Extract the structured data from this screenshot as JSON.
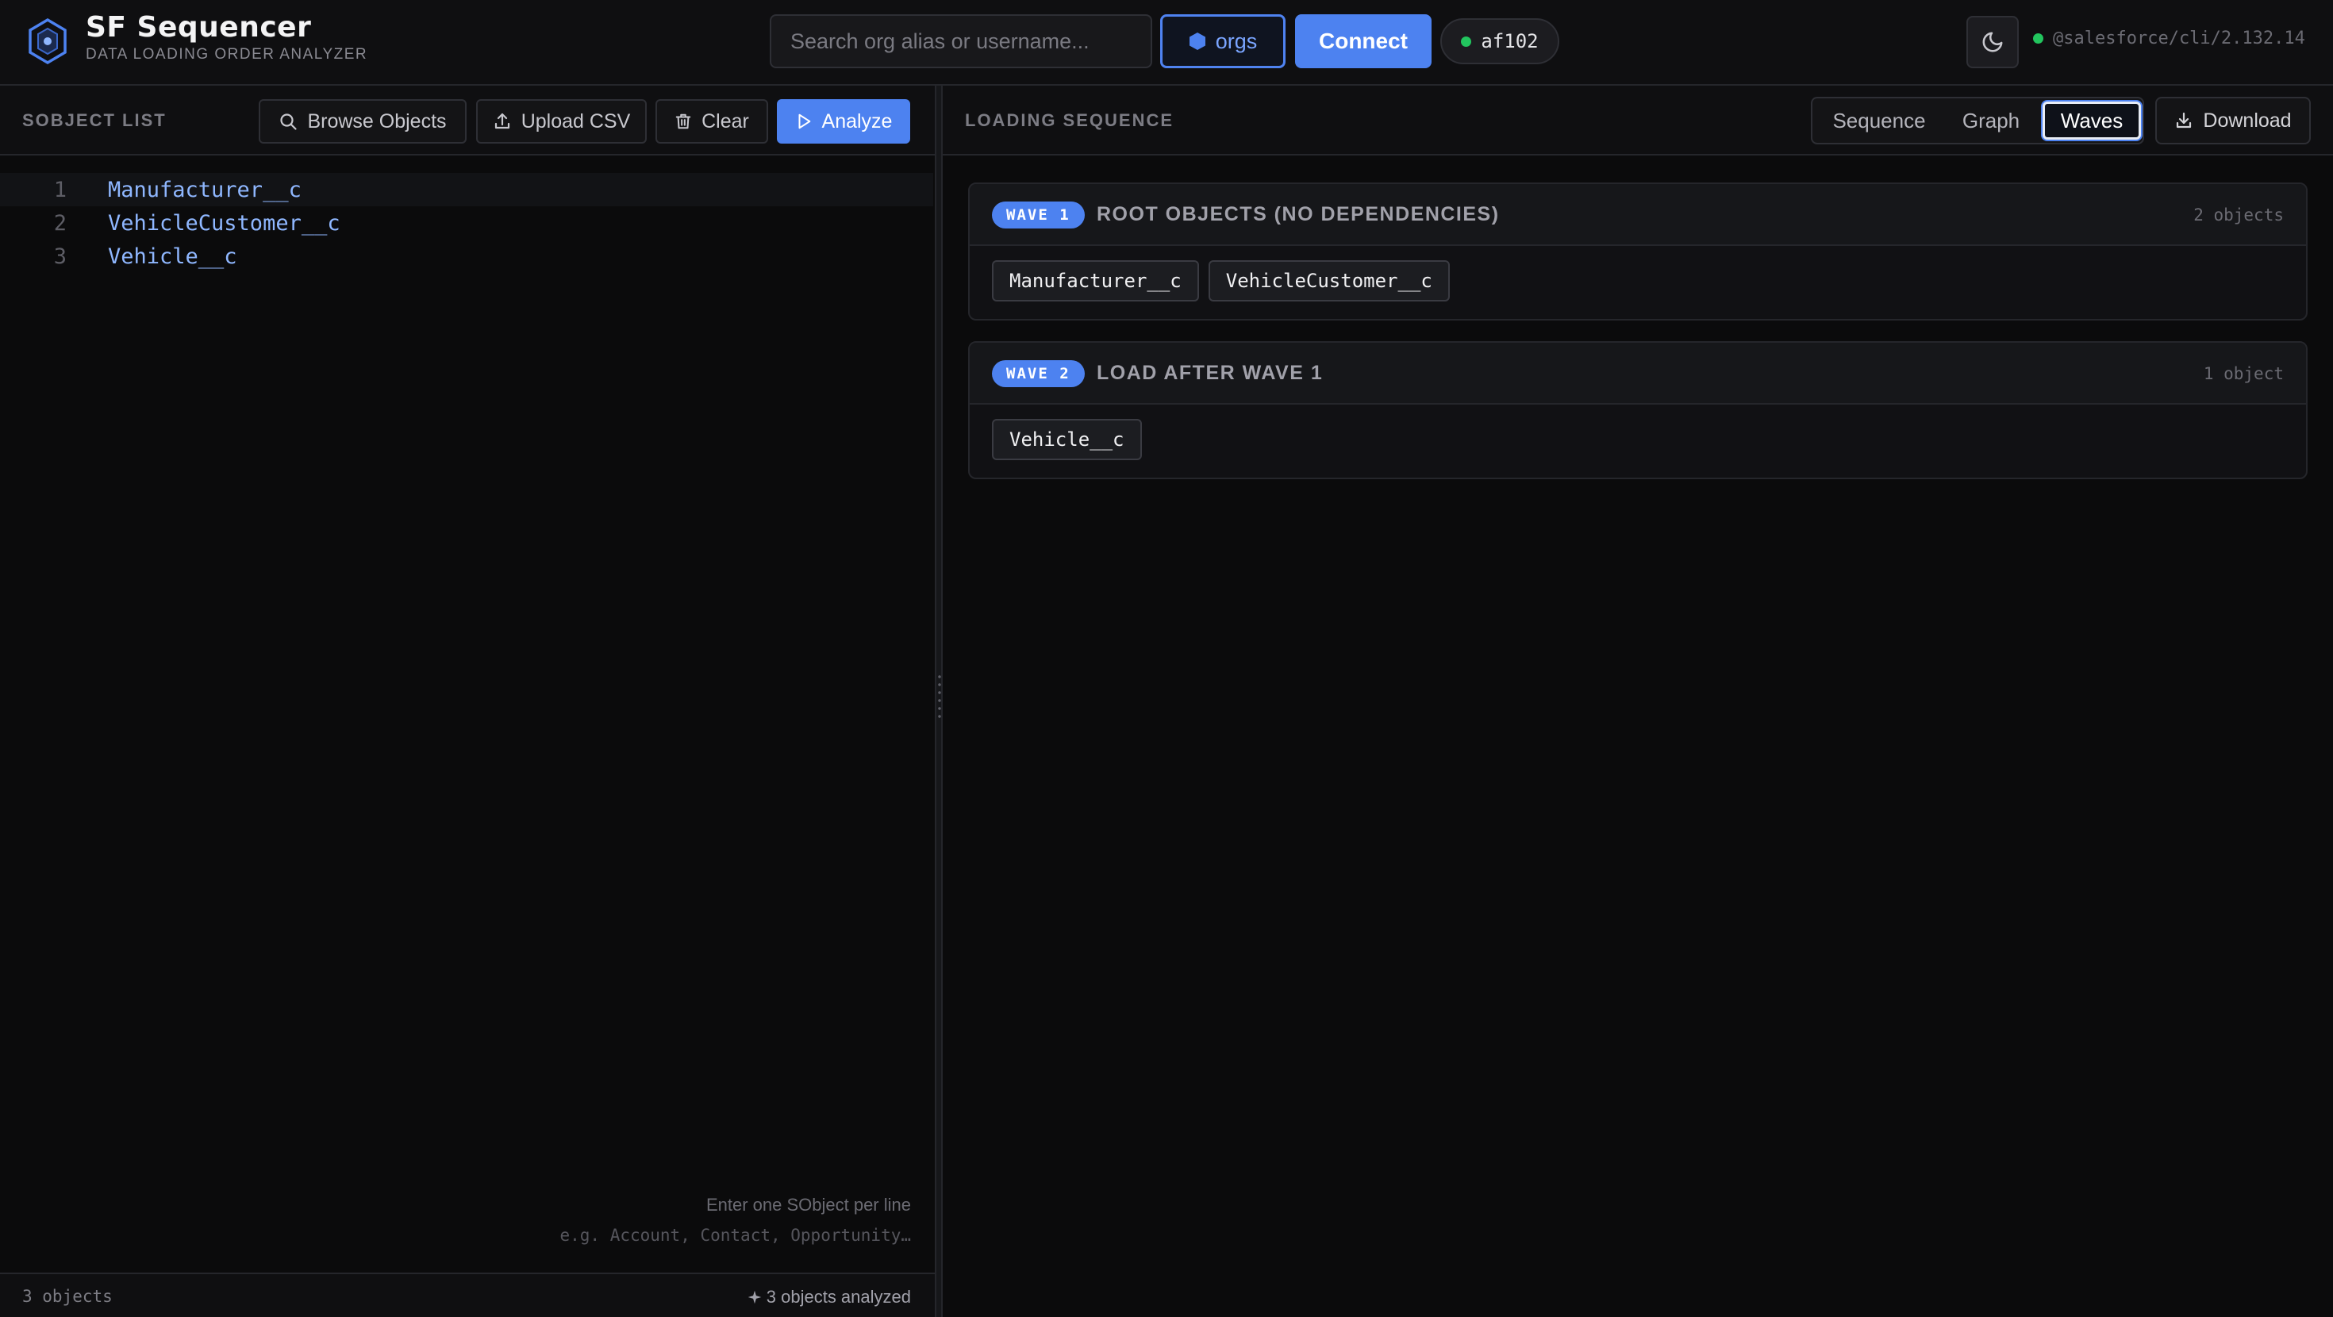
{
  "header": {
    "title": "SF Sequencer",
    "subtitle": "DATA LOADING ORDER ANALYZER",
    "search_placeholder": "Search org alias or username...",
    "orgs_label": "orgs",
    "connect_label": "Connect",
    "org_alias": "af102",
    "cli_version": "@salesforce/cli/2.132.14",
    "status_color": "#22c55e",
    "accent_color": "#4d82f0"
  },
  "left_panel": {
    "label": "SOBJECT LIST",
    "toolbar": {
      "browse_label": "Browse Objects",
      "upload_label": "Upload CSV",
      "clear_label": "Clear",
      "analyze_label": "Analyze"
    },
    "lines": [
      {
        "num": "1",
        "text": "Manufacturer__c"
      },
      {
        "num": "2",
        "text": "VehicleCustomer__c"
      },
      {
        "num": "3",
        "text": "Vehicle__c"
      }
    ],
    "hint_primary": "Enter one SObject per line",
    "hint_example": "e.g. Account, Contact, Opportunity…",
    "footer_count": "3 objects",
    "footer_status": "3 objects analyzed"
  },
  "right_panel": {
    "label": "LOADING SEQUENCE",
    "views": [
      "Sequence",
      "Graph",
      "Waves"
    ],
    "active_view": "Waves",
    "download_label": "Download",
    "waves": [
      {
        "badge": "WAVE 1",
        "title": "ROOT OBJECTS (NO DEPENDENCIES)",
        "count": "2 objects",
        "objects": [
          "Manufacturer__c",
          "VehicleCustomer__c"
        ]
      },
      {
        "badge": "WAVE 2",
        "title": "LOAD AFTER WAVE 1",
        "count": "1 object",
        "objects": [
          "Vehicle__c"
        ]
      }
    ]
  }
}
